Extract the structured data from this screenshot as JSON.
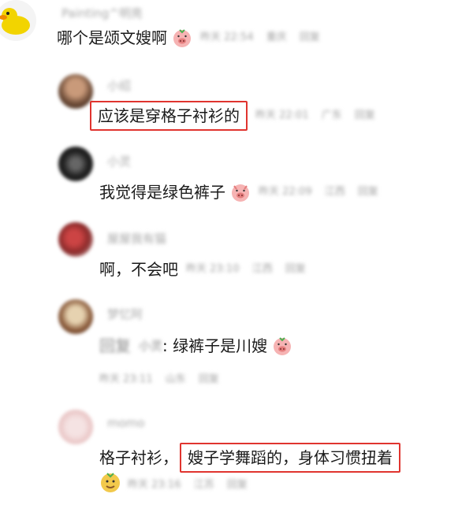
{
  "comments": [
    {
      "username": "Painting^明亮",
      "text": "哪个是颂文嫂啊",
      "time": "昨天 22:54",
      "location": "重庆",
      "reply": "回复",
      "has_emoji": true
    },
    {
      "username": "小绍",
      "text": "应该是穿格子衬衫的",
      "time": "昨天 22:01",
      "location": "广东",
      "reply": "回复",
      "highlighted": true
    },
    {
      "username": "小灵",
      "text": "我觉得是绿色裤子",
      "time": "昨天 22:09",
      "location": "江西",
      "reply": "回复",
      "has_emoji": true
    },
    {
      "username": "屋屋我有猫",
      "text": "啊，不会吧",
      "time": "昨天 23:10",
      "location": "江西",
      "reply": "回复"
    },
    {
      "username": "梦忆阿",
      "reply_to": "小灵",
      "reply_prefix": "回复",
      "text": ": 绿裤子是川嫂",
      "time": "昨天 23:11",
      "location": "山东",
      "reply": "回复",
      "has_emoji": true
    },
    {
      "username": "momo",
      "text_plain": "格子衬衫，",
      "text_highlight": "嫂子学舞蹈的，身体习惯扭着",
      "time": "昨天 23:16",
      "location": "江苏",
      "reply": "回复",
      "has_emoji": true
    }
  ],
  "colors": {
    "highlight": "#e0342f",
    "meta": "#a0a0a0",
    "text": "#1a1a1a"
  },
  "icons": [
    "duck-avatar-icon",
    "pig-emoji-icon",
    "face-emoji-icon"
  ]
}
